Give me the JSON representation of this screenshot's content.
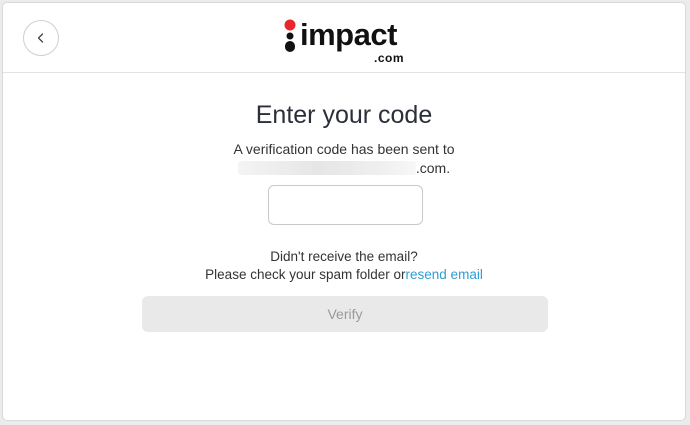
{
  "header": {
    "back_icon": "chevron-left-icon",
    "logo": {
      "word": "impact",
      "suffix": ".com",
      "dot_colors": {
        "top": "#e8262c",
        "bottom": "#111111"
      }
    }
  },
  "main": {
    "title": "Enter your code",
    "subtitle_line1": "A verification code has been sent to",
    "email_suffix": ".com.",
    "code_input": {
      "value": "",
      "placeholder": ""
    },
    "help_line1": "Didn't receive the email?",
    "help_line2": "Please check your spam folder or",
    "resend_link": "resend email",
    "verify_button": "Verify"
  },
  "colors": {
    "link": "#2b9fd6",
    "button_disabled_bg": "#e9e9ea",
    "button_disabled_text": "#9a9a9a"
  }
}
